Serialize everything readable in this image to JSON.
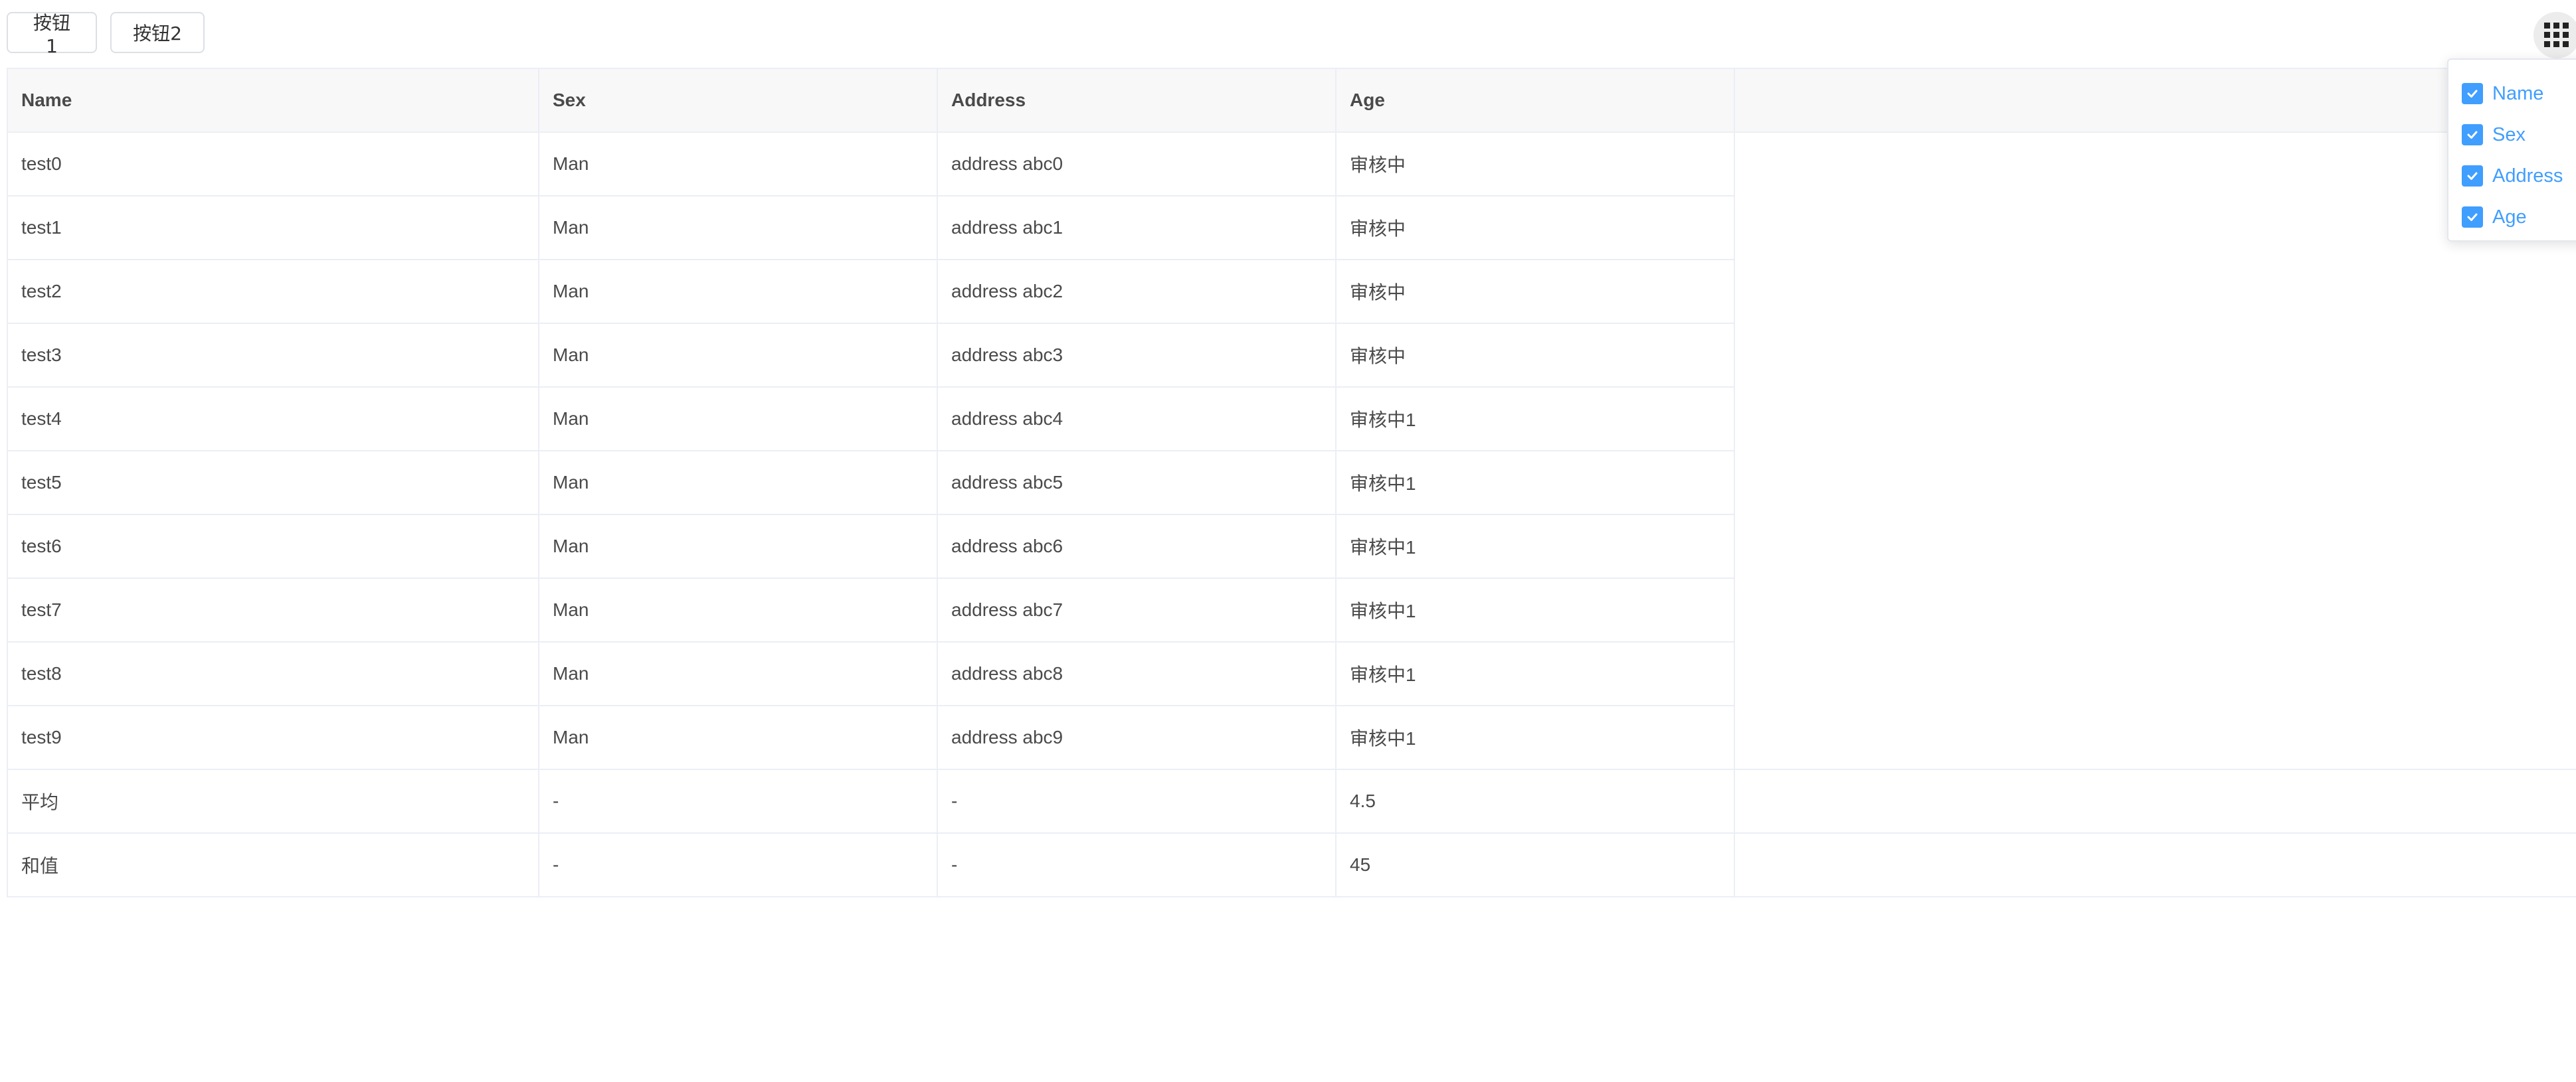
{
  "toolbar": {
    "button1_label": "按钮1",
    "button2_label": "按钮2"
  },
  "grid_toggle_icon": "grid-icon",
  "table": {
    "headers": [
      "Name",
      "Sex",
      "Address",
      "Age"
    ],
    "rows": [
      [
        "test0",
        "Man",
        "address abc0",
        "审核中"
      ],
      [
        "test1",
        "Man",
        "address abc1",
        "审核中"
      ],
      [
        "test2",
        "Man",
        "address abc2",
        "审核中"
      ],
      [
        "test3",
        "Man",
        "address abc3",
        "审核中"
      ],
      [
        "test4",
        "Man",
        "address abc4",
        "审核中1"
      ],
      [
        "test5",
        "Man",
        "address abc5",
        "审核中1"
      ],
      [
        "test6",
        "Man",
        "address abc6",
        "审核中1"
      ],
      [
        "test7",
        "Man",
        "address abc7",
        "审核中1"
      ],
      [
        "test8",
        "Man",
        "address abc8",
        "审核中1"
      ],
      [
        "test9",
        "Man",
        "address abc9",
        "审核中1"
      ]
    ],
    "summary": [
      [
        "平均",
        "-",
        "-",
        "4.5"
      ],
      [
        "和值",
        "-",
        "-",
        "45"
      ]
    ]
  },
  "column_menu": {
    "items": [
      {
        "label": "Name",
        "checked": true
      },
      {
        "label": "Sex",
        "checked": true
      },
      {
        "label": "Address",
        "checked": true
      },
      {
        "label": "Age",
        "checked": true
      }
    ]
  },
  "colors": {
    "accent": "#409eff",
    "header_bg": "#f8f8f9",
    "border": "#ebeef5"
  }
}
